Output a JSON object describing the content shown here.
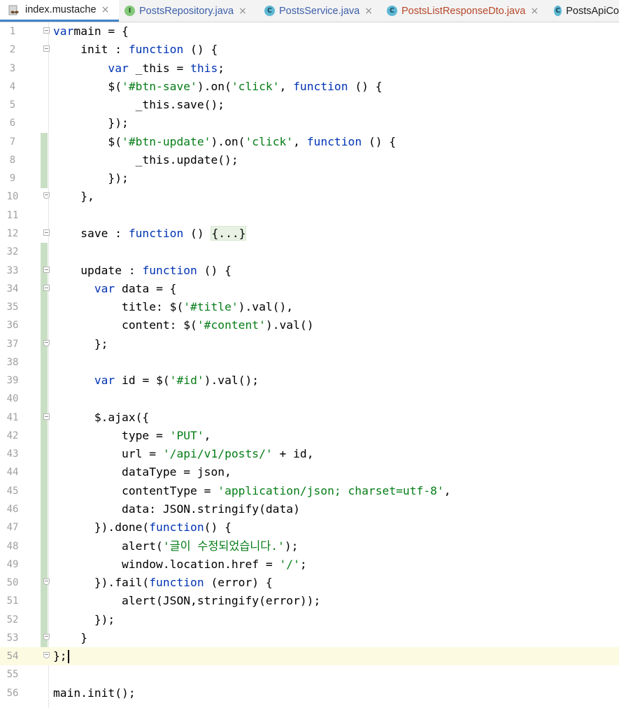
{
  "tabs": [
    {
      "label": "index.mustache",
      "icon": "mustache-file-icon",
      "active": true
    },
    {
      "label": "PostsRepository.java",
      "icon": "interface-icon",
      "icon_letter": "I"
    },
    {
      "label": "PostsService.java",
      "icon": "class-icon",
      "icon_letter": "C"
    },
    {
      "label": "PostsListResponseDto.java",
      "icon": "class-icon",
      "icon_letter": "C"
    },
    {
      "label": "PostsApiCo",
      "icon": "class-icon",
      "icon_letter": "C"
    }
  ],
  "close_glyph": "×",
  "editor": {
    "current_line": "54",
    "lines": [
      {
        "n": "1",
        "segs": [
          [
            "kw",
            "var"
          ],
          [
            "",
            "main = {"
          ]
        ]
      },
      {
        "n": "2",
        "segs": [
          [
            "",
            "    init : "
          ],
          [
            "kw",
            "function"
          ],
          [
            "",
            " () {"
          ]
        ]
      },
      {
        "n": "3",
        "segs": [
          [
            "",
            "        "
          ],
          [
            "kw",
            "var"
          ],
          [
            "",
            " _this = "
          ],
          [
            "kw",
            "this"
          ],
          [
            "",
            ";"
          ]
        ]
      },
      {
        "n": "4",
        "segs": [
          [
            "",
            "        $("
          ],
          [
            "str",
            "'#btn-save'"
          ],
          [
            "",
            ").on("
          ],
          [
            "str",
            "'click'"
          ],
          [
            "",
            ", "
          ],
          [
            "kw",
            "function"
          ],
          [
            "",
            " () {"
          ]
        ]
      },
      {
        "n": "5",
        "segs": [
          [
            "",
            "            _this.save();"
          ]
        ]
      },
      {
        "n": "6",
        "segs": [
          [
            "",
            "        });"
          ]
        ]
      },
      {
        "n": "7",
        "segs": [
          [
            "",
            "        $("
          ],
          [
            "str",
            "'#btn-update'"
          ],
          [
            "",
            ").on("
          ],
          [
            "str",
            "'click'"
          ],
          [
            "",
            ", "
          ],
          [
            "kw",
            "function"
          ],
          [
            "",
            " () {"
          ]
        ]
      },
      {
        "n": "8",
        "segs": [
          [
            "",
            "            _this.update();"
          ]
        ]
      },
      {
        "n": "9",
        "segs": [
          [
            "",
            "        });"
          ]
        ]
      },
      {
        "n": "10",
        "segs": [
          [
            "",
            "    },"
          ]
        ]
      },
      {
        "n": "11",
        "segs": []
      },
      {
        "n": "12",
        "segs": [
          [
            "",
            "    save : "
          ],
          [
            "kw",
            "function"
          ],
          [
            "",
            " () "
          ],
          [
            "folded",
            "{...}"
          ]
        ]
      },
      {
        "n": "32",
        "segs": []
      },
      {
        "n": "33",
        "segs": [
          [
            "",
            "    update : "
          ],
          [
            "kw",
            "function"
          ],
          [
            "",
            " () {"
          ]
        ]
      },
      {
        "n": "34",
        "segs": [
          [
            "",
            "      "
          ],
          [
            "kw",
            "var"
          ],
          [
            "",
            " data = {"
          ]
        ]
      },
      {
        "n": "35",
        "segs": [
          [
            "",
            "          title: $("
          ],
          [
            "str",
            "'#title'"
          ],
          [
            "",
            ").val(),"
          ]
        ]
      },
      {
        "n": "36",
        "segs": [
          [
            "",
            "          content: $("
          ],
          [
            "str",
            "'#content'"
          ],
          [
            "",
            ").val()"
          ]
        ]
      },
      {
        "n": "37",
        "segs": [
          [
            "",
            "      };"
          ]
        ]
      },
      {
        "n": "38",
        "segs": []
      },
      {
        "n": "39",
        "segs": [
          [
            "",
            "      "
          ],
          [
            "kw",
            "var"
          ],
          [
            "",
            " id = $("
          ],
          [
            "str",
            "'#id'"
          ],
          [
            "",
            ").val();"
          ]
        ]
      },
      {
        "n": "40",
        "segs": []
      },
      {
        "n": "41",
        "segs": [
          [
            "",
            "      $.ajax({"
          ]
        ]
      },
      {
        "n": "42",
        "segs": [
          [
            "",
            "          type = "
          ],
          [
            "str",
            "'PUT'"
          ],
          [
            "",
            ","
          ]
        ]
      },
      {
        "n": "43",
        "segs": [
          [
            "",
            "          url = "
          ],
          [
            "str",
            "'/api/v1/posts/'"
          ],
          [
            "",
            " + id,"
          ]
        ]
      },
      {
        "n": "44",
        "segs": [
          [
            "",
            "          dataType = json,"
          ]
        ]
      },
      {
        "n": "45",
        "segs": [
          [
            "",
            "          contentType = "
          ],
          [
            "str",
            "'application/json; charset=utf-8'"
          ],
          [
            "",
            ","
          ]
        ]
      },
      {
        "n": "46",
        "segs": [
          [
            "",
            "          data: JSON.stringify(data)"
          ]
        ]
      },
      {
        "n": "47",
        "segs": [
          [
            "",
            "      }).done("
          ],
          [
            "kw",
            "function"
          ],
          [
            "",
            "() {"
          ]
        ]
      },
      {
        "n": "48",
        "segs": [
          [
            "",
            "          alert("
          ],
          [
            "str",
            "'글이 수정되었습니다.'"
          ],
          [
            "",
            ");"
          ]
        ]
      },
      {
        "n": "49",
        "segs": [
          [
            "",
            "          window.location.href = "
          ],
          [
            "str",
            "'/'"
          ],
          [
            "",
            ";"
          ]
        ]
      },
      {
        "n": "50",
        "segs": [
          [
            "",
            "      }).fail("
          ],
          [
            "kw",
            "function"
          ],
          [
            "",
            " (error) {"
          ]
        ]
      },
      {
        "n": "51",
        "segs": [
          [
            "",
            "          alert(JSON,stringify(error));"
          ]
        ]
      },
      {
        "n": "52",
        "segs": [
          [
            "",
            "      });"
          ]
        ]
      },
      {
        "n": "53",
        "segs": [
          [
            "",
            "    }"
          ]
        ]
      },
      {
        "n": "54",
        "segs": [
          [
            "",
            "};"
          ]
        ]
      },
      {
        "n": "55",
        "segs": []
      },
      {
        "n": "56",
        "segs": [
          [
            "",
            "main.init();"
          ]
        ]
      }
    ]
  }
}
